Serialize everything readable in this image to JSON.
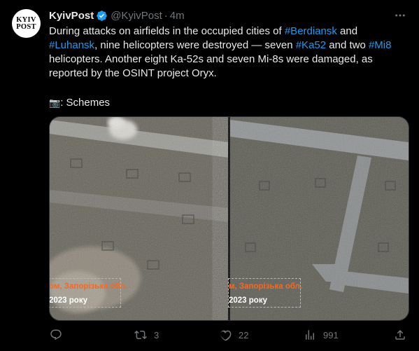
{
  "tweet": {
    "avatar": {
      "line1": "KYIV",
      "line2": "POST"
    },
    "author_name": "KyivPost",
    "handle": "@KyivPost",
    "separator": "·",
    "time": "4m",
    "text": {
      "l1_a": "During attacks on airfields in the occupied cities of ",
      "l1_tag": "#Berdiansk",
      "l1_b": " and",
      "l2_tag": "#Luhansk",
      "l2_a": ", nine helicopters were destroyed — seven ",
      "l2_tag2": "#Ka52",
      "l2_b": " and two ",
      "l2_tag3": "#Mi8",
      "l3": "helicopters. Another eight Ka-52s and seven Mi-8s were damaged, as",
      "l4": "reported by the OSINT project Oryx.",
      "l5_icon": "📷",
      "l5": ": Schemes"
    },
    "media": {
      "left_stamp_line1": "ом, Запорізька обл.",
      "left_stamp_line2": "2023 року",
      "right_stamp_line1": "м, Запорізька обл.",
      "right_stamp_line2": "2023 року"
    },
    "actions": {
      "reply_count": "",
      "retweet_count": "3",
      "like_count": "22",
      "views_count": "991"
    },
    "icons": [
      "verified-icon",
      "more-icon",
      "reply-icon",
      "retweet-icon",
      "like-icon",
      "views-icon",
      "share-icon"
    ],
    "colors": {
      "link": "#1d9bf0",
      "muted": "#71767b",
      "text": "#e7e9ea",
      "stamp_orange": "#f26a25"
    }
  }
}
